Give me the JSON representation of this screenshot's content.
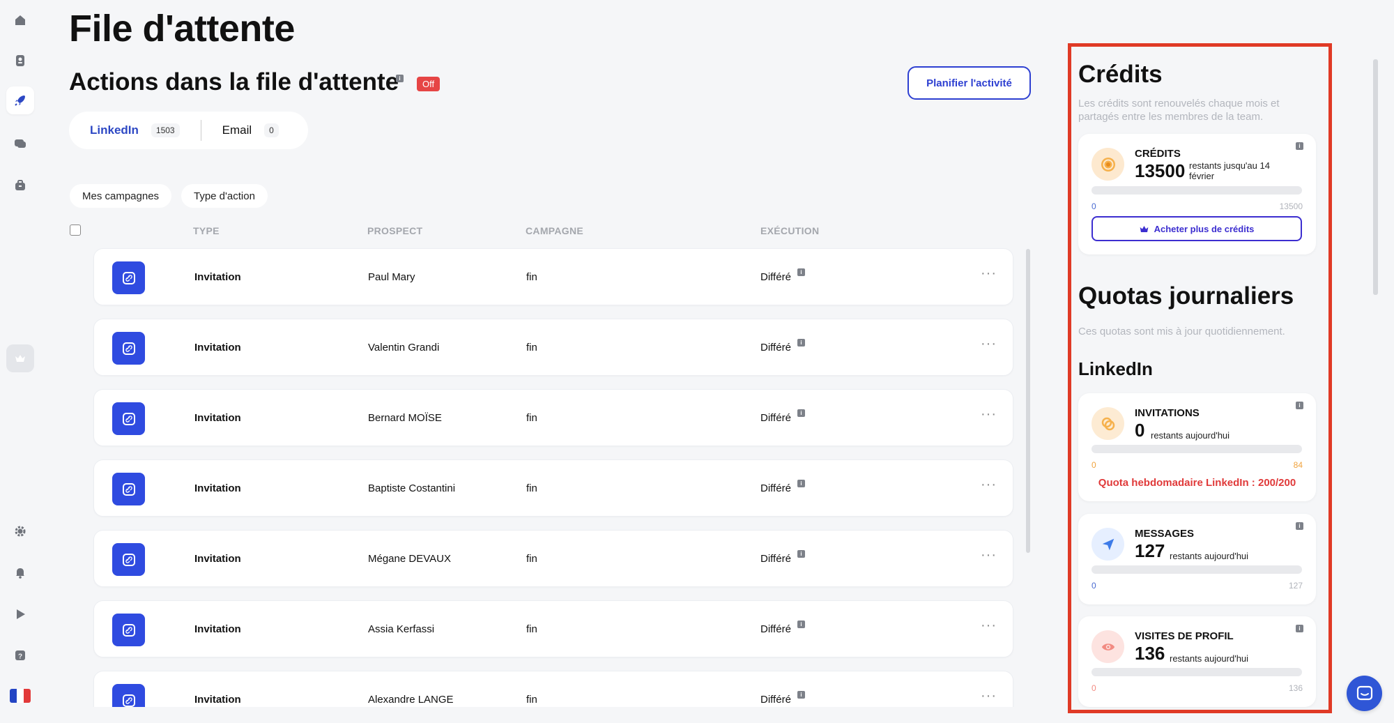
{
  "page": {
    "title": "File d'attente"
  },
  "queue": {
    "title": "Actions dans la file d'attente",
    "status_badge": "Off",
    "plan_button": "Planifier l'activité",
    "tabs": [
      {
        "label": "LinkedIn",
        "count": "1503"
      },
      {
        "label": "Email",
        "count": "0"
      }
    ],
    "filters": [
      "Mes campagnes",
      "Type d'action"
    ],
    "columns": [
      "TYPE",
      "PROSPECT",
      "CAMPAGNE",
      "EXÉCUTION"
    ],
    "rows": [
      {
        "type": "Invitation",
        "prospect": "Paul Mary",
        "campaign": "fin",
        "execution": "Différé"
      },
      {
        "type": "Invitation",
        "prospect": "Valentin Grandi",
        "campaign": "fin",
        "execution": "Différé"
      },
      {
        "type": "Invitation",
        "prospect": "Bernard MOÏSE",
        "campaign": "fin",
        "execution": "Différé"
      },
      {
        "type": "Invitation",
        "prospect": "Baptiste Costantini",
        "campaign": "fin",
        "execution": "Différé"
      },
      {
        "type": "Invitation",
        "prospect": "Mégane DEVAUX",
        "campaign": "fin",
        "execution": "Différé"
      },
      {
        "type": "Invitation",
        "prospect": "Assia Kerfassi",
        "campaign": "fin",
        "execution": "Différé"
      },
      {
        "type": "Invitation",
        "prospect": "Alexandre LANGE",
        "campaign": "fin",
        "execution": "Différé"
      }
    ]
  },
  "credits": {
    "title": "Crédits",
    "description": "Les crédits sont renouvelés chaque mois et partagés entre les membres de la team.",
    "card": {
      "label": "CRÉDITS",
      "value": "13500",
      "sub_line1": "restants jusqu'au 14",
      "sub_line2": "février",
      "range_min": "0",
      "range_max": "13500",
      "button": "Acheter plus de crédits"
    }
  },
  "quotas": {
    "title": "Quotas journaliers",
    "description": "Ces quotas sont mis à jour quotidiennement.",
    "linkedin_title": "LinkedIn",
    "invitations": {
      "label": "INVITATIONS",
      "value": "0",
      "sub": "restants aujourd'hui",
      "range_min": "0",
      "range_max": "84",
      "warning": "Quota hebdomadaire LinkedIn : 200/200"
    },
    "messages": {
      "label": "MESSAGES",
      "value": "127",
      "sub": "restants aujourd'hui",
      "range_min": "0",
      "range_max": "127"
    },
    "visits": {
      "label": "VISITES DE PROFIL",
      "value": "136",
      "sub": "restants aujourd'hui",
      "range_min": "0",
      "range_max": "136"
    }
  },
  "icons": {
    "info": "i",
    "row_menu": "···"
  },
  "colors": {
    "primary": "#2f4be0",
    "accent_link": "#2d48c4",
    "danger": "#e03a3a",
    "highlight_border": "#e03a26",
    "credits_icon_bg": "#fde9cf",
    "invitations_icon_bg": "#fdebd3",
    "messages_icon_bg": "#e6efff",
    "visits_icon_bg": "#fde3e0"
  }
}
